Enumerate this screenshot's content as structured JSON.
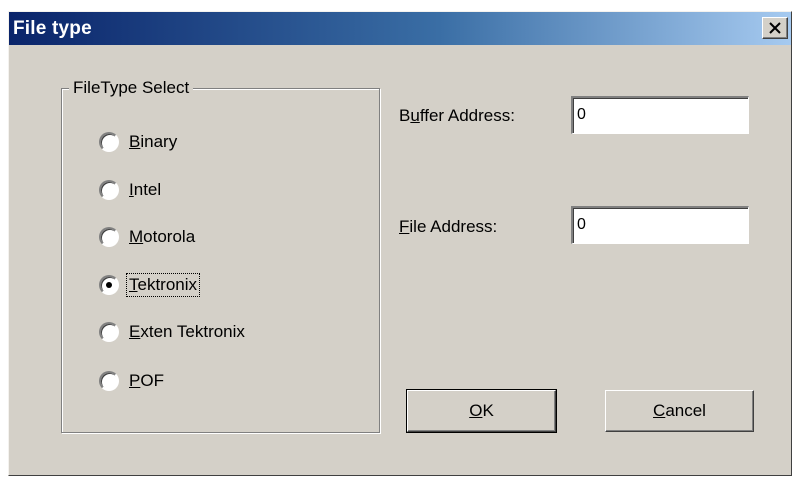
{
  "window": {
    "title": "File type",
    "close_glyph": "✕"
  },
  "group": {
    "legend": "FileType Select",
    "options": [
      {
        "label": "Binary",
        "mnemonic": "B",
        "rest": "inary",
        "selected": false
      },
      {
        "label": "Intel",
        "mnemonic": "I",
        "rest": "ntel",
        "selected": false
      },
      {
        "label": "Motorola",
        "mnemonic": "M",
        "rest": "otorola",
        "selected": false
      },
      {
        "label": "Tektronix",
        "mnemonic": "T",
        "rest": "ektronix",
        "selected": true
      },
      {
        "label": "Exten Tektronix",
        "mnemonic": "E",
        "rest": "xten Tektronix",
        "selected": false
      },
      {
        "label": "POF",
        "mnemonic": "P",
        "rest": "OF",
        "selected": false
      }
    ]
  },
  "fields": {
    "buffer_label_pre": "B",
    "buffer_label_mn": "u",
    "buffer_label_post": "ffer Address:",
    "buffer_value": "0",
    "file_label_mn": "F",
    "file_label_post": "ile Address:",
    "file_value": "0"
  },
  "buttons": {
    "ok_mn": "O",
    "ok_rest": "K",
    "cancel_mn": "C",
    "cancel_rest": "ancel"
  },
  "colors": {
    "titlebar_start": "#0a246a",
    "titlebar_end": "#a6caf0",
    "dialog_bg": "#d4d0c8"
  }
}
